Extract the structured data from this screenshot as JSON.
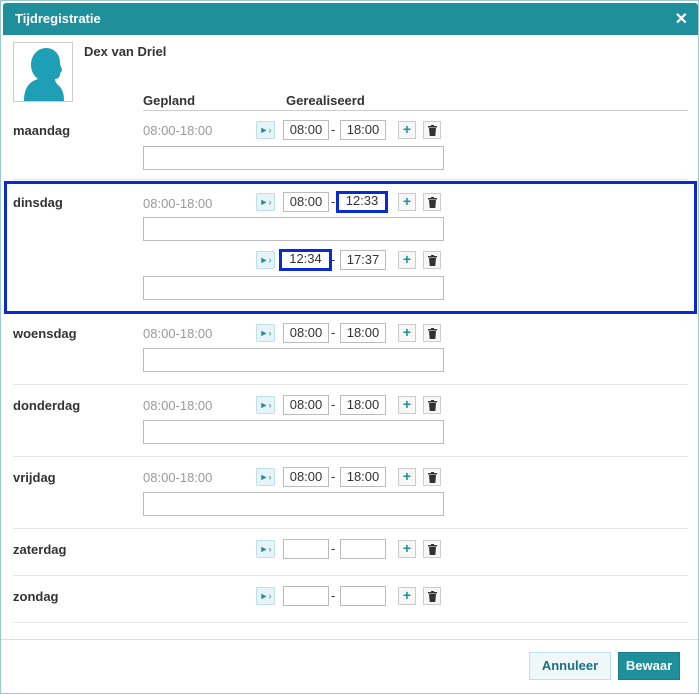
{
  "dialog": {
    "title": "Tijdregistratie",
    "close_icon": "close-icon"
  },
  "user": {
    "name": "Dex van Driel",
    "avatar_icon": "person-silhouette-icon"
  },
  "columns": {
    "planned": "Gepland",
    "realized": "Gerealiseerd"
  },
  "days": [
    {
      "name": "maandag",
      "planned": "08:00-18:00",
      "entries": [
        {
          "start": "08:00",
          "end": "18:00"
        }
      ]
    },
    {
      "name": "dinsdag",
      "planned": "08:00-18:00",
      "entries": [
        {
          "start": "08:00",
          "end": "12:33"
        },
        {
          "start": "12:34",
          "end": "17:37"
        }
      ]
    },
    {
      "name": "woensdag",
      "planned": "08:00-18:00",
      "entries": [
        {
          "start": "08:00",
          "end": "18:00"
        }
      ]
    },
    {
      "name": "donderdag",
      "planned": "08:00-18:00",
      "entries": [
        {
          "start": "08:00",
          "end": "18:00"
        }
      ]
    },
    {
      "name": "vrijdag",
      "planned": "08:00-18:00",
      "entries": [
        {
          "start": "08:00",
          "end": "18:00"
        }
      ]
    },
    {
      "name": "zaterdag",
      "planned": "",
      "entries": [
        {
          "start": "",
          "end": ""
        }
      ]
    },
    {
      "name": "zondag",
      "planned": "",
      "entries": [
        {
          "start": "",
          "end": ""
        }
      ]
    }
  ],
  "separator": "-",
  "play_glyph": "►›",
  "plus_glyph": "+",
  "icons": {
    "play": "fill-play-icon",
    "plus": "add-entry-icon",
    "trash": "trash-icon"
  },
  "footer": {
    "cancel_label": "Annuleer",
    "save_label": "Bewaar"
  },
  "colors": {
    "accent": "#1f8f9c",
    "highlight": "#0a2ccf"
  }
}
